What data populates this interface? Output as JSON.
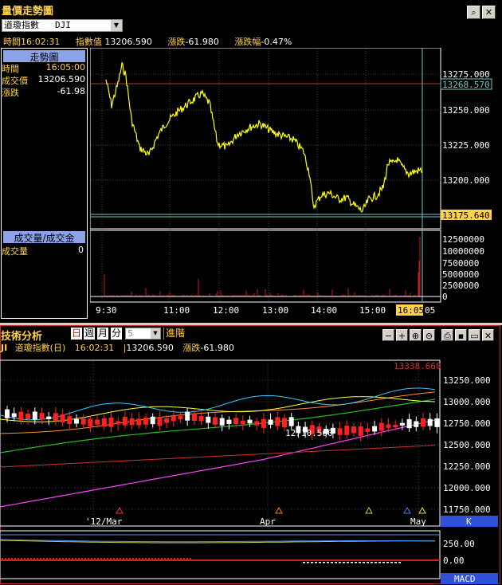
{
  "top": {
    "title": "量價走勢圖",
    "select_value": "道瓊指數",
    "symbol": "DJI",
    "info_time_label": "時間",
    "info_time": "16:02:31",
    "info_index_label": "指數值",
    "info_index": "13206.590",
    "info_change_label": "漲跌",
    "info_change": "-61.980",
    "info_pct_label": "漲跌幅",
    "info_pct": "-0.47%",
    "side_header": "走勢圖",
    "side_time_label": "時間",
    "side_time": "16:05:00",
    "side_price_label": "成交價",
    "side_price": "13206.590",
    "side_change_label": "漲跌",
    "side_change": "-61.98",
    "vol_header": "成交量/成交金",
    "vol_label": "成交量",
    "vol_value": "0",
    "y_ticks": [
      "13275.000",
      "13250.000",
      "13225.000",
      "13200.000"
    ],
    "ref_high": "13268.570",
    "ref_low": "13175.640",
    "vol_ticks": [
      "12500000",
      "10000000",
      "7500000",
      "5000000",
      "2500000",
      "0"
    ],
    "x_ticks": [
      "9:30",
      "11:00",
      "12:00",
      "13:00",
      "14:00",
      "15:00"
    ],
    "x_current": "16:05",
    "x_end": "05"
  },
  "bottom": {
    "title": "技術分析",
    "period_day": "日",
    "period_week": "週",
    "period_month": "月",
    "period_min": "分",
    "period_num": "5",
    "advanced": "進階",
    "symbol": "JI",
    "name": "道瓊指數(日)",
    "time": "16:02:31",
    "value": "13206.590",
    "change_label": "漲跌",
    "change": "-61.980",
    "high_label": "13338.660",
    "low_label": "12710.560",
    "y_ticks": [
      "13250.000",
      "13000.000",
      "12750.000",
      "12500.000",
      "12250.000",
      "12000.000",
      "11750.000"
    ],
    "x_ticks": [
      "'12/Mar",
      "Apr",
      "May"
    ],
    "k_label": "K",
    "macd_ticks": [
      "250.00",
      "0.00"
    ],
    "macd_label": "MACD"
  },
  "colors": {
    "price_line": "#ffff00",
    "ref_high_line": "#c03030",
    "ref_low_line": "#6fc7c7",
    "accent": "#ffd24a",
    "up_candle": "#ff2020",
    "down_candle": "#ffffff"
  },
  "icons": [
    "zoom-icon",
    "close-icon",
    "minus-icon",
    "plus-icon",
    "zoom-in-icon",
    "zoom-out-icon",
    "print-icon",
    "save-icon",
    "window-icon",
    "close-icon"
  ]
}
